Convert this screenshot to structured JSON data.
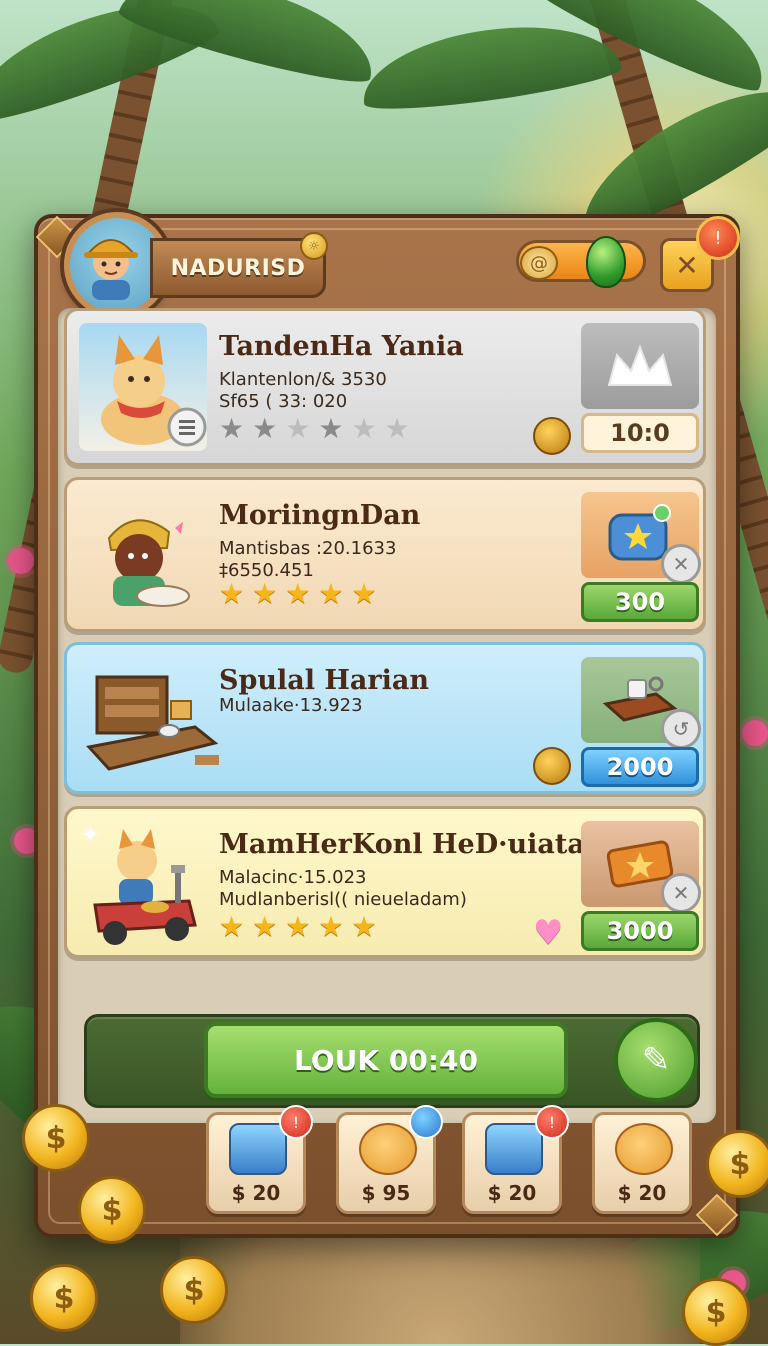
{
  "header": {
    "player_name": "NADURISD",
    "close_icon": "close-icon",
    "alert_icon": "alert-icon",
    "gem_icon": "gem-icon",
    "energy_icon": "swirl-icon"
  },
  "cards": [
    {
      "title": "TandenHa Yania",
      "line1": "Klantenlon/& 3530",
      "line2": "Sf65 ( 33: 020",
      "stars": 4,
      "star_max": 6,
      "price": "10:0",
      "price_style": "plain",
      "extra_icon": "coin-icon",
      "item_icon": "crown-icon"
    },
    {
      "title": "MoriingnDan",
      "line1": "Mantisbas :20.1633",
      "line2": "‡6550.451",
      "stars": 5,
      "star_max": 5,
      "price": "300",
      "price_style": "green",
      "item_icon": "chest-icon"
    },
    {
      "title": "Spulal Harian",
      "line1": "Mulaake·13.923",
      "line2": "",
      "stars": 0,
      "price": "2000",
      "price_style": "blue",
      "extra_icon": "coin-icon",
      "item_icon": "toolbox-icon"
    },
    {
      "title": "MamHerKonl HeD·uiatals",
      "line1": "Malacinc·15.023",
      "line2": "Mudlanberisl(( nieueladam)",
      "stars": 5,
      "star_max": 5,
      "price": "3000",
      "price_style": "green",
      "extra_icon": "heart-icon",
      "item_icon": "ticket-icon"
    }
  ],
  "action": {
    "main_label": "LOUK 00:40",
    "edit_icon": "pencil-icon"
  },
  "bottom_items": [
    {
      "price": "$ 20",
      "icon": "chest-icon",
      "badge": "!"
    },
    {
      "price": "$ 95",
      "icon": "pet-icon",
      "badge": ""
    },
    {
      "price": "$ 20",
      "icon": "chest-icon",
      "badge": "!"
    },
    {
      "price": "$ 20",
      "icon": "pet-icon",
      "badge": ""
    }
  ],
  "colors": {
    "wood": "#8e5a2f",
    "green_button": "#64b23d",
    "blue_button": "#2f91dc",
    "star": "#f7b51b"
  }
}
